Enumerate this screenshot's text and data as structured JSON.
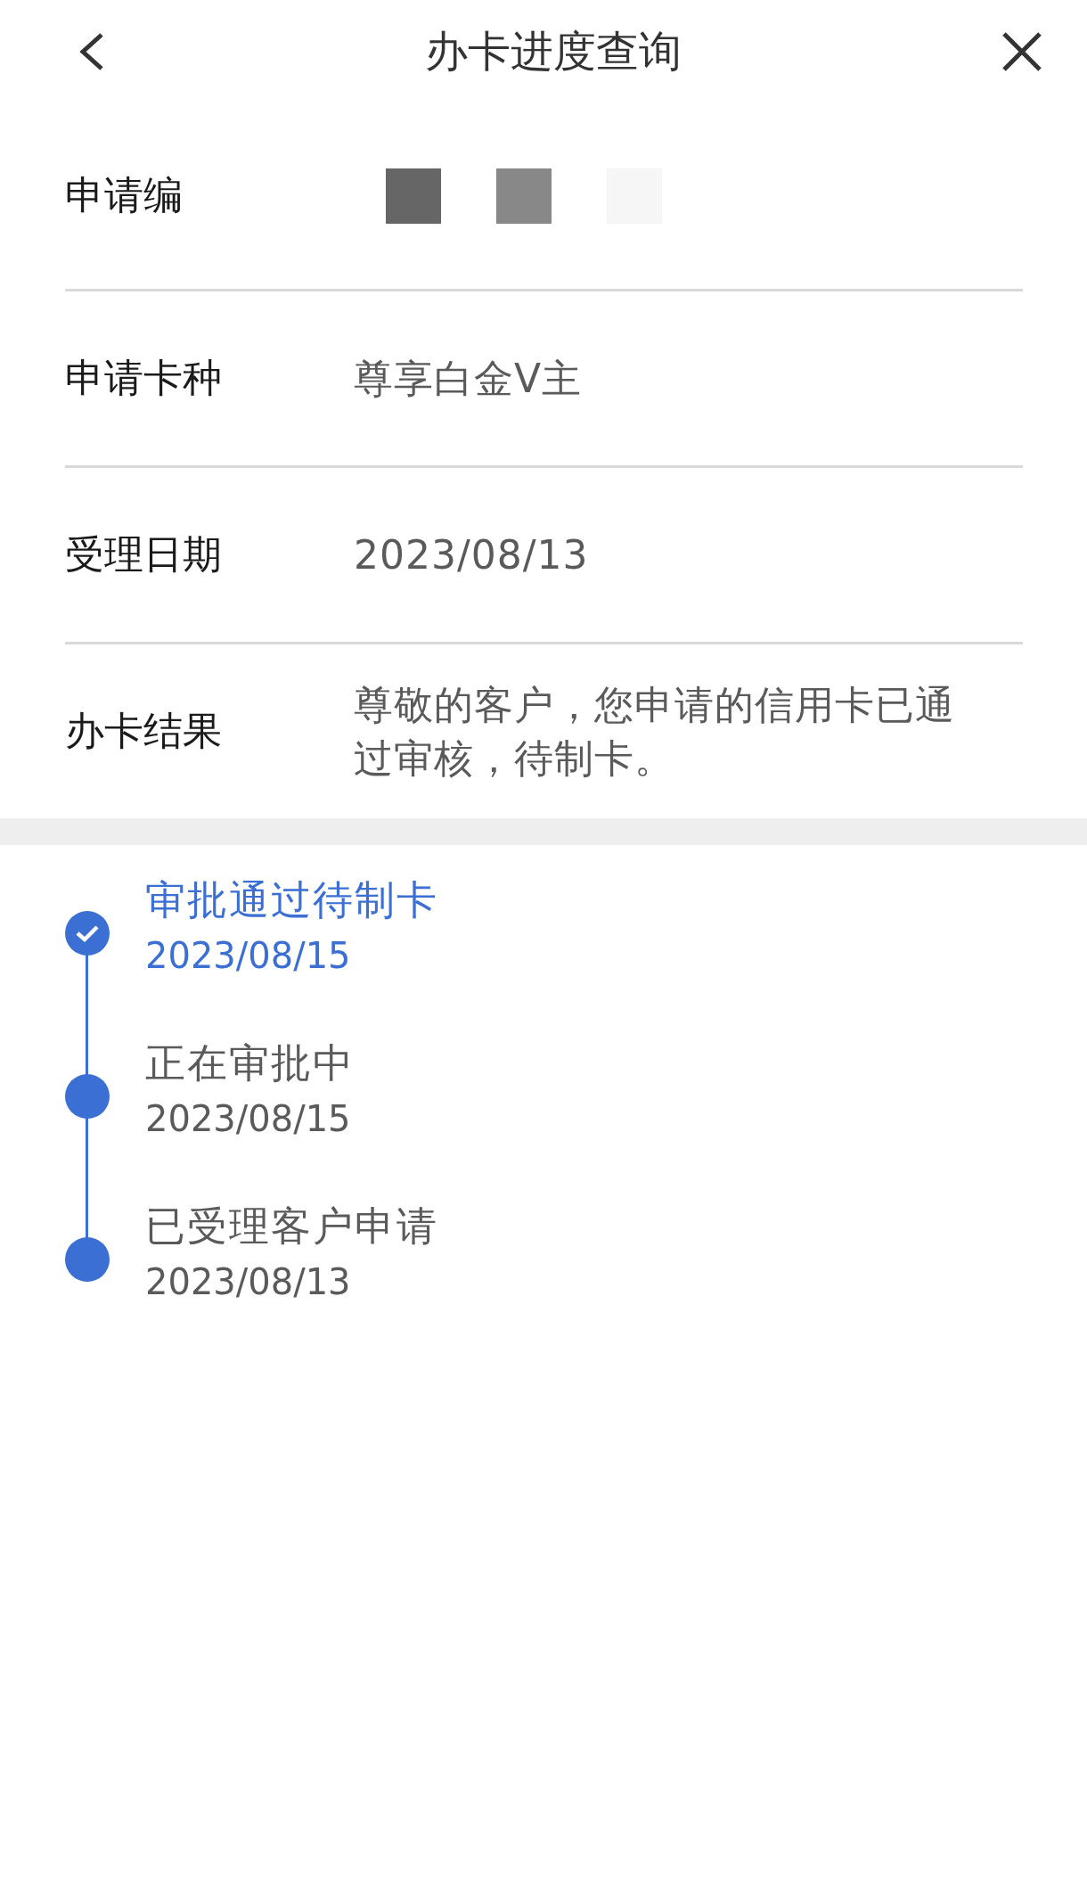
{
  "header": {
    "title": "办卡进度查询"
  },
  "fields": [
    {
      "label": "申请编",
      "kind": "masked"
    },
    {
      "label": "申请卡种",
      "kind": "text",
      "value": "尊享白金V主"
    },
    {
      "label": "受理日期",
      "kind": "text",
      "value": "2023/08/13"
    },
    {
      "label": "办卡结果",
      "kind": "text",
      "value": "尊敬的客户，您申请的信用卡已通过审核，待制卡。"
    }
  ],
  "timeline": [
    {
      "title": "审批通过待制卡",
      "date": "2023/08/15",
      "current": true
    },
    {
      "title": "正在审批中",
      "date": "2023/08/15",
      "current": false
    },
    {
      "title": "已受理客户申请",
      "date": "2023/08/13",
      "current": false
    }
  ]
}
